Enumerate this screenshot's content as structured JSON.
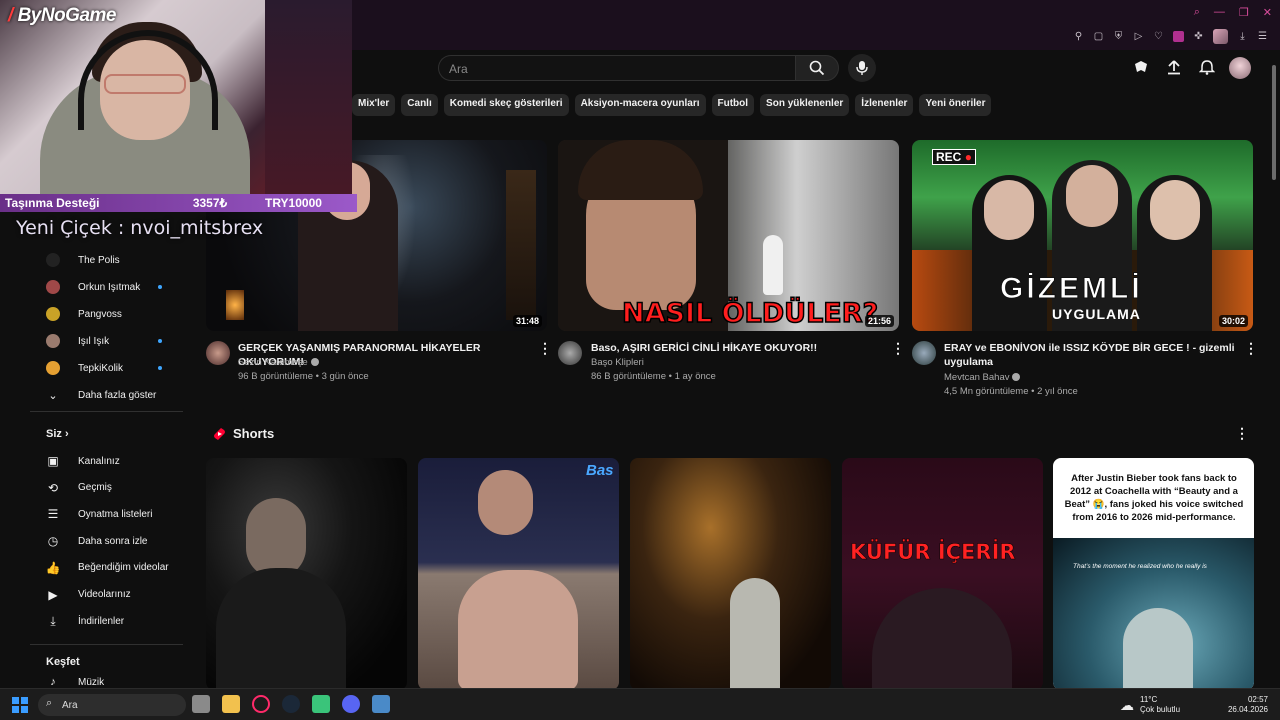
{
  "browser": {
    "search_placeholder": "Ara"
  },
  "chips": [
    "Mix'ler",
    "Canlı",
    "Komedi skeç gösterileri",
    "Aksiyon-macera oyunları",
    "Futbol",
    "Son yüklenenler",
    "İzlenenler",
    "Yeni öneriler"
  ],
  "sidebar": {
    "channels": [
      {
        "label": "The Polis",
        "live": false,
        "color": "#222"
      },
      {
        "label": "Orkun Işıtmak",
        "live": true,
        "color": "#a04848"
      },
      {
        "label": "Pangvoss",
        "live": false,
        "color": "#c9a227"
      },
      {
        "label": "Işıl Işık",
        "live": true,
        "color": "#9a7b6e"
      },
      {
        "label": "TepkiKolik",
        "live": true,
        "color": "#e5a032"
      }
    ],
    "show_more": "Daha fazla göster",
    "you_heading": "Siz",
    "you_items": [
      "Kanalınız",
      "Geçmiş",
      "Oynatma listeleri",
      "Daha sonra izle",
      "Beğendiğim videolar",
      "Videolarınız",
      "İndirilenler"
    ],
    "explore_heading": "Keşfet",
    "explore_items": [
      "Müzik"
    ]
  },
  "overlay": {
    "logo": "ByNoGame",
    "donation_label": "Taşınma Desteği",
    "donation_amount": "3357₺",
    "donation_goal": "TRY10000",
    "donation_message": "Yeni Çiçek : nvoi_mitsbrex"
  },
  "videos": [
    {
      "title": "GERÇEK YAŞANMIŞ PARANORMAL HİKAYELER OKUYORUM!",
      "channel": "Sezin Karameşe",
      "verified": true,
      "meta": "96 B görüntüleme • 3 gün önce",
      "duration": "31:48"
    },
    {
      "title": "Baso, AŞIRI GERİCİ CİNLİ HİKAYE OKUYOR!!",
      "channel": "Başo Klipleri",
      "verified": false,
      "meta": "86 B görüntüleme • 1 ay önce",
      "duration": "21:56",
      "thumb_text": "NASIL ÖLDÜLER?"
    },
    {
      "title": "ERAY ve EBONİVON ile ISSIZ KÖYDE BİR GECE ! - gizemli uygulama",
      "channel": "Mevtcan Bahav",
      "verified": true,
      "meta": "4,5 Mn görüntüleme • 2 yıl önce",
      "duration": "30:02",
      "thumb_text": "GİZEMLİ",
      "thumb_sub": "UYGULAMA",
      "rec": "REC"
    }
  ],
  "shorts": {
    "heading": "Shorts",
    "items": [
      {
        "text": ""
      },
      {
        "text": "Bas"
      },
      {
        "text": ""
      },
      {
        "text": "KÜFÜR İÇERİR"
      },
      {
        "text": "After Justin Bieber took fans back to 2012 at Coachella with “Beauty and a Beat” 😭, fans joked his voice switched from 2016 to 2026 mid-performance.",
        "caption": "That’s the moment he realized who he really is"
      }
    ]
  },
  "taskbar": {
    "search": "Ara",
    "temp": "11°C",
    "weather": "Çok bulutlu",
    "time": "02:57",
    "date": "26.04.2026"
  },
  "colors": {
    "accent_red": "#ff0033",
    "live_blue": "#3ea6ff",
    "donation_purple": "#8a44b8"
  }
}
